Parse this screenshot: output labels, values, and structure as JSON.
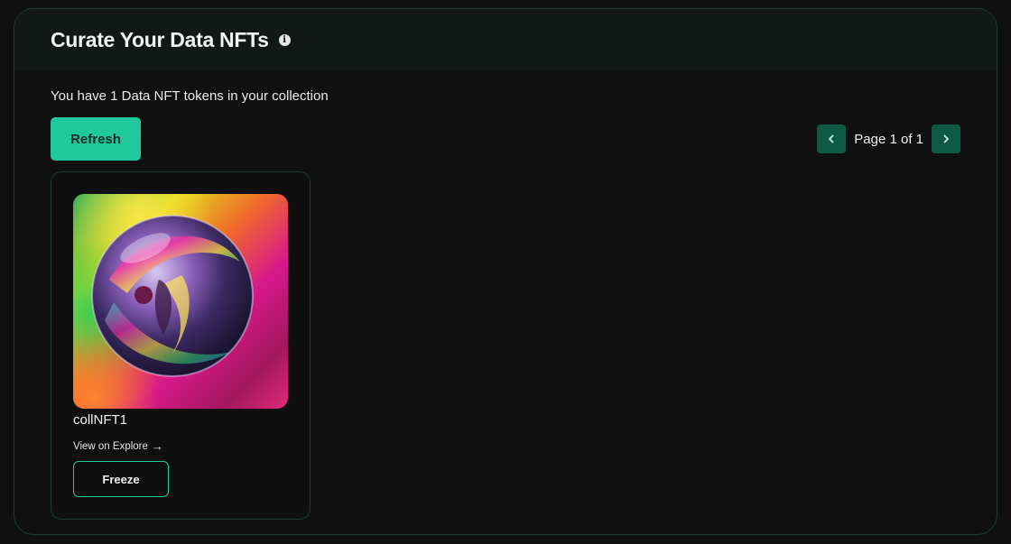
{
  "header": {
    "title": "Curate Your Data NFTs",
    "info_icon": "info-icon"
  },
  "collection": {
    "count_text": "You have 1 Data NFT tokens in your collection",
    "refresh_label": "Refresh"
  },
  "pagination": {
    "prev_icon": "chevron-left-icon",
    "label": "Page 1 of 1",
    "next_icon": "chevron-right-icon"
  },
  "nfts": [
    {
      "name": "collNFT1",
      "explore_label": "View on Explore",
      "explore_icon": "arrow-right-icon",
      "freeze_label": "Freeze"
    }
  ],
  "colors": {
    "accent": "#1fc99b",
    "pager_button": "#0e5a44",
    "background": "#101010",
    "header_background": "#111816",
    "border": "#1d3b30"
  }
}
